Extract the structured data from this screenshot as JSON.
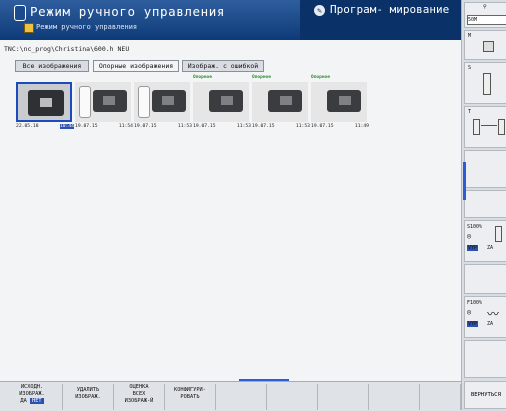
{
  "header": {
    "title": "Режим ручного управления",
    "subtitle": "Режим ручного управления",
    "program_title": "Програм- мирование"
  },
  "path": "TNC:\\nc_prog\\Christina\\600.h NEU",
  "tabs": [
    "Все изображения",
    "Опорные изображения",
    "Изображ. с ошибкой"
  ],
  "thumbnails": [
    {
      "label": "",
      "date": "22.05.18",
      "time": "10:44"
    },
    {
      "label": "",
      "date": "19.07.15",
      "time": "11:54"
    },
    {
      "label": "",
      "date": "19.07.15",
      "time": "11:53"
    },
    {
      "label": "Опорное",
      "date": "19.07.15",
      "time": "11:53"
    },
    {
      "label": "Опорное",
      "date": "19.07.15",
      "time": "11:53"
    },
    {
      "label": "Опорное",
      "date": "19.07.15",
      "time": "11:49"
    }
  ],
  "sidebar": {
    "top_value": "50M",
    "m_label": "M",
    "s_label": "S",
    "t_label": "T",
    "s_override": "S100%",
    "s_state": "VYP",
    "s_right": "ZA",
    "f_override": "F100%",
    "f_state": "VYP",
    "f_right": "ZA"
  },
  "softkeys": {
    "k1_l1": "ИСХОДН.",
    "k1_l2": "ИЗОБРАЖ.",
    "k1_l3a": "ДА",
    "k1_l3b": "НЕТ",
    "k2_l1": "УДАЛИТЬ",
    "k2_l2": "ИЗОБРАЖ.",
    "k3_l1": "ОЦЕНКА",
    "k3_l2": "ВСЕХ",
    "k3_l3": "ИЗОБРАЖ-Й",
    "k4_l1": "КОНФИГУРИ-",
    "k4_l2": "РОВАТЬ",
    "k9": "ВЕРНУТЬСЯ"
  }
}
